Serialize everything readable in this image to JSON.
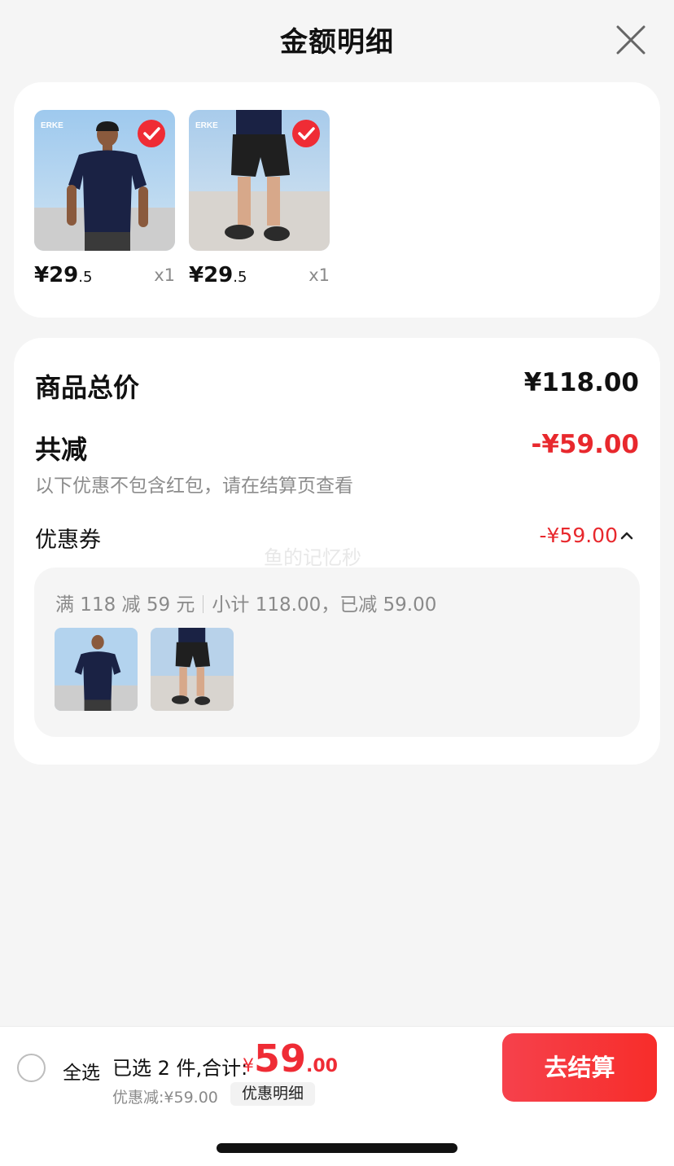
{
  "header": {
    "title": "金额明细"
  },
  "products": [
    {
      "price_int": "¥29",
      "price_dec": ".5",
      "qty": "x1",
      "image": "navy-tshirt-photo"
    },
    {
      "price_int": "¥29",
      "price_dec": ".5",
      "qty": "x1",
      "image": "black-shorts-photo"
    }
  ],
  "summary": {
    "total_label": "商品总价",
    "total_value": "¥118.00",
    "reduce_label": "共减",
    "reduce_value": "-¥59.00",
    "note": "以下优惠不包含红包，请在结算页查看",
    "coupon_label": "优惠券",
    "coupon_value": "-¥59.00",
    "watermark": "鱼的记忆秒",
    "coupon_rule": "满 118 减 59 元",
    "coupon_subtotal": "小计 118.00，已减 59.00"
  },
  "bottom_bar": {
    "select_all": "全选",
    "selected_text": "已选 2 件,合计:",
    "total_symbol": "¥",
    "total_int": "59",
    "total_dec": ".00",
    "discount_note": "优惠减:¥59.00",
    "detail_label": "优惠明细",
    "checkout_label": "去结算"
  },
  "colors": {
    "accent_red": "#ef2c35",
    "background": "#f5f5f5"
  }
}
